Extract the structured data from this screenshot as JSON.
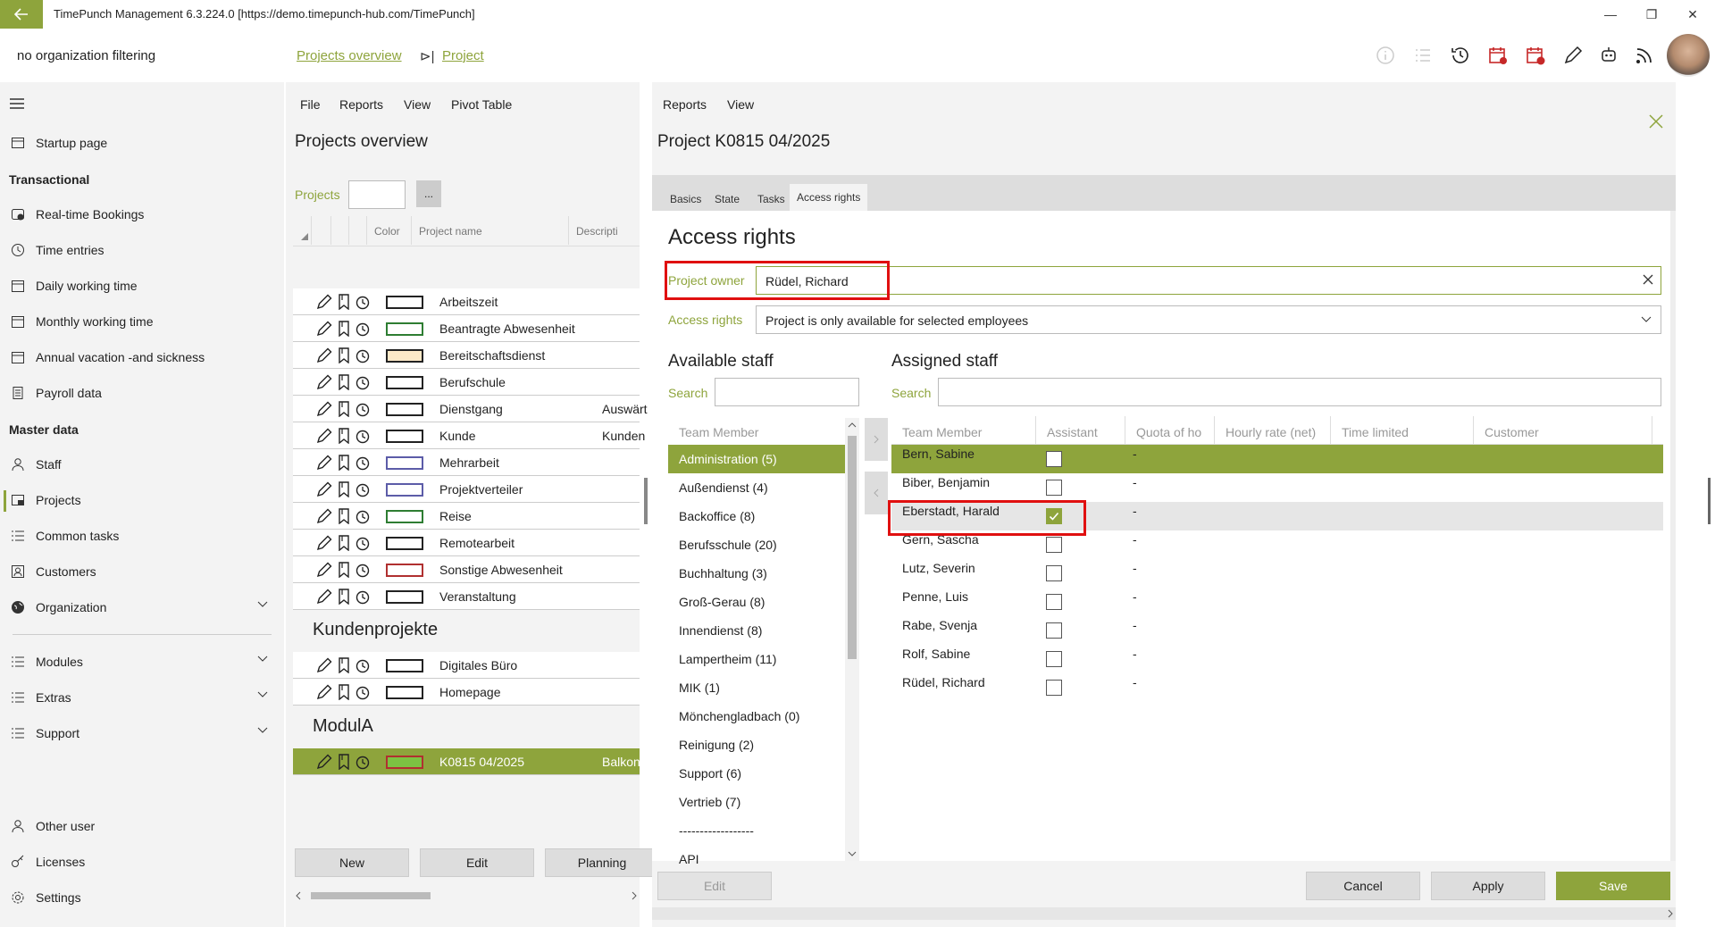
{
  "window": {
    "title": "TimePunch Management 6.3.224.0 [https://demo.timepunch-hub.com/TimePunch]",
    "minimize": "—",
    "maximize": "❐",
    "close": "✕"
  },
  "header": {
    "org_filter": "no organization filtering",
    "breadcrumb_1": "Projects overview",
    "breadcrumb_sep": "⊳|",
    "breadcrumb_2": "Project"
  },
  "sidebar": {
    "items": [
      {
        "label": "Startup page",
        "icon": "home-icon"
      },
      {
        "label": "Real-time Bookings",
        "icon": "realtime-icon"
      },
      {
        "label": "Time entries",
        "icon": "clock-icon"
      },
      {
        "label": "Daily working time",
        "icon": "calendar-day-icon"
      },
      {
        "label": "Monthly working time",
        "icon": "calendar-month-icon"
      },
      {
        "label": "Annual vacation -and sickness",
        "icon": "calendar-year-icon"
      },
      {
        "label": "Payroll data",
        "icon": "payroll-icon"
      },
      {
        "label": "Staff",
        "icon": "person-icon"
      },
      {
        "label": "Projects",
        "icon": "projects-icon"
      },
      {
        "label": "Common tasks",
        "icon": "list-icon"
      },
      {
        "label": "Customers",
        "icon": "customers-icon"
      },
      {
        "label": "Organization",
        "icon": "globe-icon"
      },
      {
        "label": "Modules",
        "icon": "list-icon"
      },
      {
        "label": "Extras",
        "icon": "list-icon"
      },
      {
        "label": "Support",
        "icon": "list-icon"
      },
      {
        "label": "Other user",
        "icon": "person-icon"
      },
      {
        "label": "Licenses",
        "icon": "key-icon"
      },
      {
        "label": "Settings",
        "icon": "gear-icon"
      }
    ],
    "heading_transactional": "Transactional",
    "heading_master": "Master data"
  },
  "left_panel": {
    "menu": [
      "File",
      "Reports",
      "View",
      "Pivot Table"
    ],
    "title": "Projects overview",
    "projects_label": "Projects",
    "more_label": "...",
    "col_color": "Color",
    "col_name": "Project name",
    "col_desc": "Descripti",
    "rows": [
      {
        "name": "Arbeitszeit",
        "desc": "",
        "color": "#ffffff",
        "border": "#222222"
      },
      {
        "name": "Beantragte Abwesenheit",
        "desc": "",
        "color": "#ffffff",
        "border": "#2e7d32"
      },
      {
        "name": "Bereitschaftsdienst",
        "desc": "",
        "color": "#fde9c8",
        "border": "#222222"
      },
      {
        "name": "Berufschule",
        "desc": "",
        "color": "#ffffff",
        "border": "#222222"
      },
      {
        "name": "Dienstgang",
        "desc": "Auswärt",
        "color": "#ffffff",
        "border": "#222222"
      },
      {
        "name": "Kunde",
        "desc": "Kunden",
        "color": "#ffffff",
        "border": "#222222"
      },
      {
        "name": "Mehrarbeit",
        "desc": "",
        "color": "#ffffff",
        "border": "#5c5ca8"
      },
      {
        "name": "Projektverteiler",
        "desc": "",
        "color": "#ffffff",
        "border": "#5c5ca8"
      },
      {
        "name": "Reise",
        "desc": "",
        "color": "#ffffff",
        "border": "#2e7d32"
      },
      {
        "name": "Remotearbeit",
        "desc": "",
        "color": "#ffffff",
        "border": "#222222"
      },
      {
        "name": "Sonstige Abwesenheit",
        "desc": "",
        "color": "#ffffff",
        "border": "#b03030"
      },
      {
        "name": "Veranstaltung",
        "desc": "",
        "color": "#ffffff",
        "border": "#222222"
      }
    ],
    "group_kunden": "Kundenprojekte",
    "kunden_rows": [
      {
        "name": "Digitales Büro",
        "desc": "",
        "color": "#ffffff",
        "border": "#222222"
      },
      {
        "name": "Homepage",
        "desc": "",
        "color": "#ffffff",
        "border": "#222222"
      }
    ],
    "group_modula": "ModulA",
    "modula_rows": [
      {
        "name": "K0815 04/2025",
        "desc": "Balkona",
        "color": "#7cc242",
        "border": "#b03030"
      }
    ],
    "btn_new": "New",
    "btn_edit": "Edit",
    "btn_planning": "Planning"
  },
  "right_panel": {
    "menu": [
      "Reports",
      "View"
    ],
    "title": "Project K0815 04/2025",
    "tabs": [
      "Basics",
      "State",
      "Tasks",
      "Access rights"
    ],
    "section_title": "Access rights",
    "owner_label": "Project owner",
    "owner_value": "Rüdel, Richard",
    "access_label": "Access rights",
    "access_value": "Project is only available for selected employees",
    "available_title": "Available staff",
    "assigned_title": "Assigned staff",
    "search_label": "Search",
    "avail_col": "Team Member",
    "teams": [
      "Administration (5)",
      "Außendienst (4)",
      "Backoffice (8)",
      "Berufsschule (20)",
      "Buchhaltung (3)",
      "Groß-Gerau (8)",
      "Innendienst (8)",
      "Lampertheim (11)",
      "MIK (1)",
      "Mönchengladbach (0)",
      "Reinigung (2)",
      "Support (6)",
      "Vertrieb (7)",
      "------------------",
      "API"
    ],
    "assigned_cols": [
      "Team Member",
      "Assistant",
      "Quota of ho",
      "Hourly rate (net)",
      "Time limited",
      "Customer"
    ],
    "assigned": [
      {
        "name": "Bern, Sabine",
        "assistant": false,
        "quota": "-"
      },
      {
        "name": "Biber, Benjamin",
        "assistant": false,
        "quota": "-"
      },
      {
        "name": "Eberstadt, Harald",
        "assistant": true,
        "quota": "-"
      },
      {
        "name": "Gern, Sascha",
        "assistant": false,
        "quota": "-"
      },
      {
        "name": "Lutz, Severin",
        "assistant": false,
        "quota": "-"
      },
      {
        "name": "Penne, Luis",
        "assistant": false,
        "quota": "-"
      },
      {
        "name": "Rabe, Svenja",
        "assistant": false,
        "quota": "-"
      },
      {
        "name": "Rolf, Sabine",
        "assistant": false,
        "quota": "-"
      },
      {
        "name": "Rüdel, Richard",
        "assistant": false,
        "quota": "-"
      }
    ],
    "btn_edit": "Edit",
    "btn_cancel": "Cancel",
    "btn_apply": "Apply",
    "btn_save": "Save"
  },
  "colors": {
    "accent": "#8ea43c",
    "highlight": "#e01010",
    "panel_bg": "#f3f3f3"
  }
}
